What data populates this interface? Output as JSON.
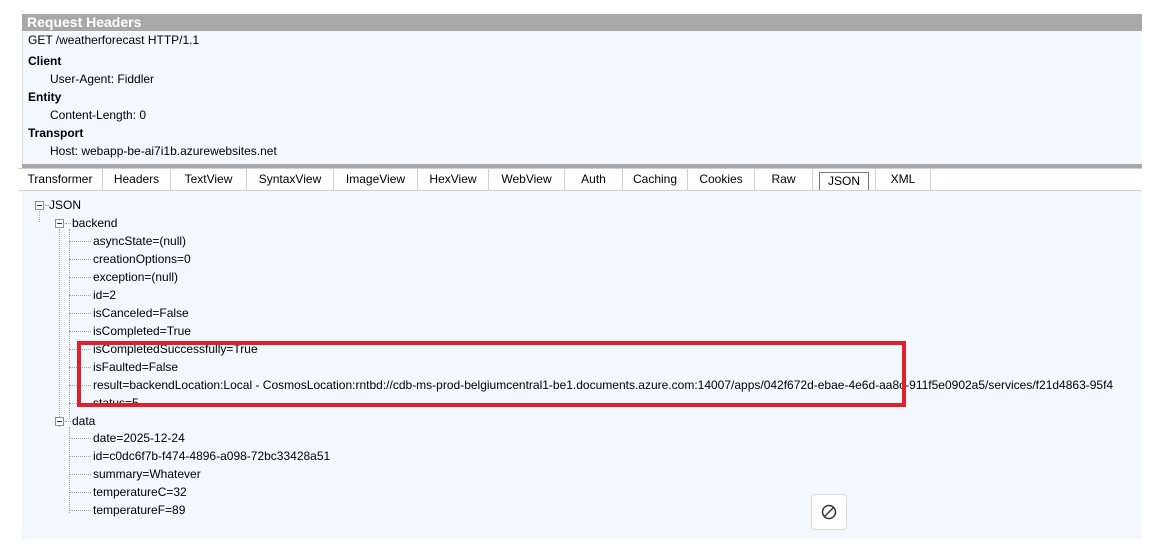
{
  "request_headers": {
    "title": "Request Headers",
    "request_line": "GET /weatherforecast HTTP/1.1",
    "groups": [
      {
        "name": "Client",
        "items": [
          "User-Agent: Fiddler"
        ]
      },
      {
        "name": "Entity",
        "items": [
          "Content-Length: 0"
        ]
      },
      {
        "name": "Transport",
        "items": [
          "Host: webapp-be-ai7i1b.azurewebsites.net"
        ]
      }
    ]
  },
  "tabs": [
    "Transformer",
    "Headers",
    "TextView",
    "SyntaxView",
    "ImageView",
    "HexView",
    "WebView",
    "Auth",
    "Caching",
    "Cookies",
    "Raw",
    "JSON",
    "XML"
  ],
  "active_tab": "JSON",
  "tree": {
    "root": "JSON",
    "backend": {
      "label": "backend",
      "items": [
        "asyncState=(null)",
        "creationOptions=0",
        "exception=(null)",
        "id=2",
        "isCanceled=False",
        "isCompleted=True",
        "isCompletedSuccessfully=True",
        "isFaulted=False",
        "result=backendLocation:Local - CosmosLocation:rntbd://cdb-ms-prod-belgiumcentral1-be1.documents.azure.com:14007/apps/042f672d-ebae-4e6d-aa8c-911f5e0902a5/services/f21d4863-95f4",
        "status=5"
      ]
    },
    "data": {
      "label": "data",
      "items": [
        "date=2025-12-24",
        "id=c0dc6f7b-f474-4896-a098-72bc33428a51",
        "summary=Whatever",
        "temperatureC=32",
        "temperatureF=89"
      ]
    }
  },
  "colors": {
    "highlight": "#e0202a",
    "panel_bg": "#f2f8fd",
    "header_bar": "#a8a8a8"
  },
  "icons": {
    "floating_button": "cancel-icon"
  }
}
